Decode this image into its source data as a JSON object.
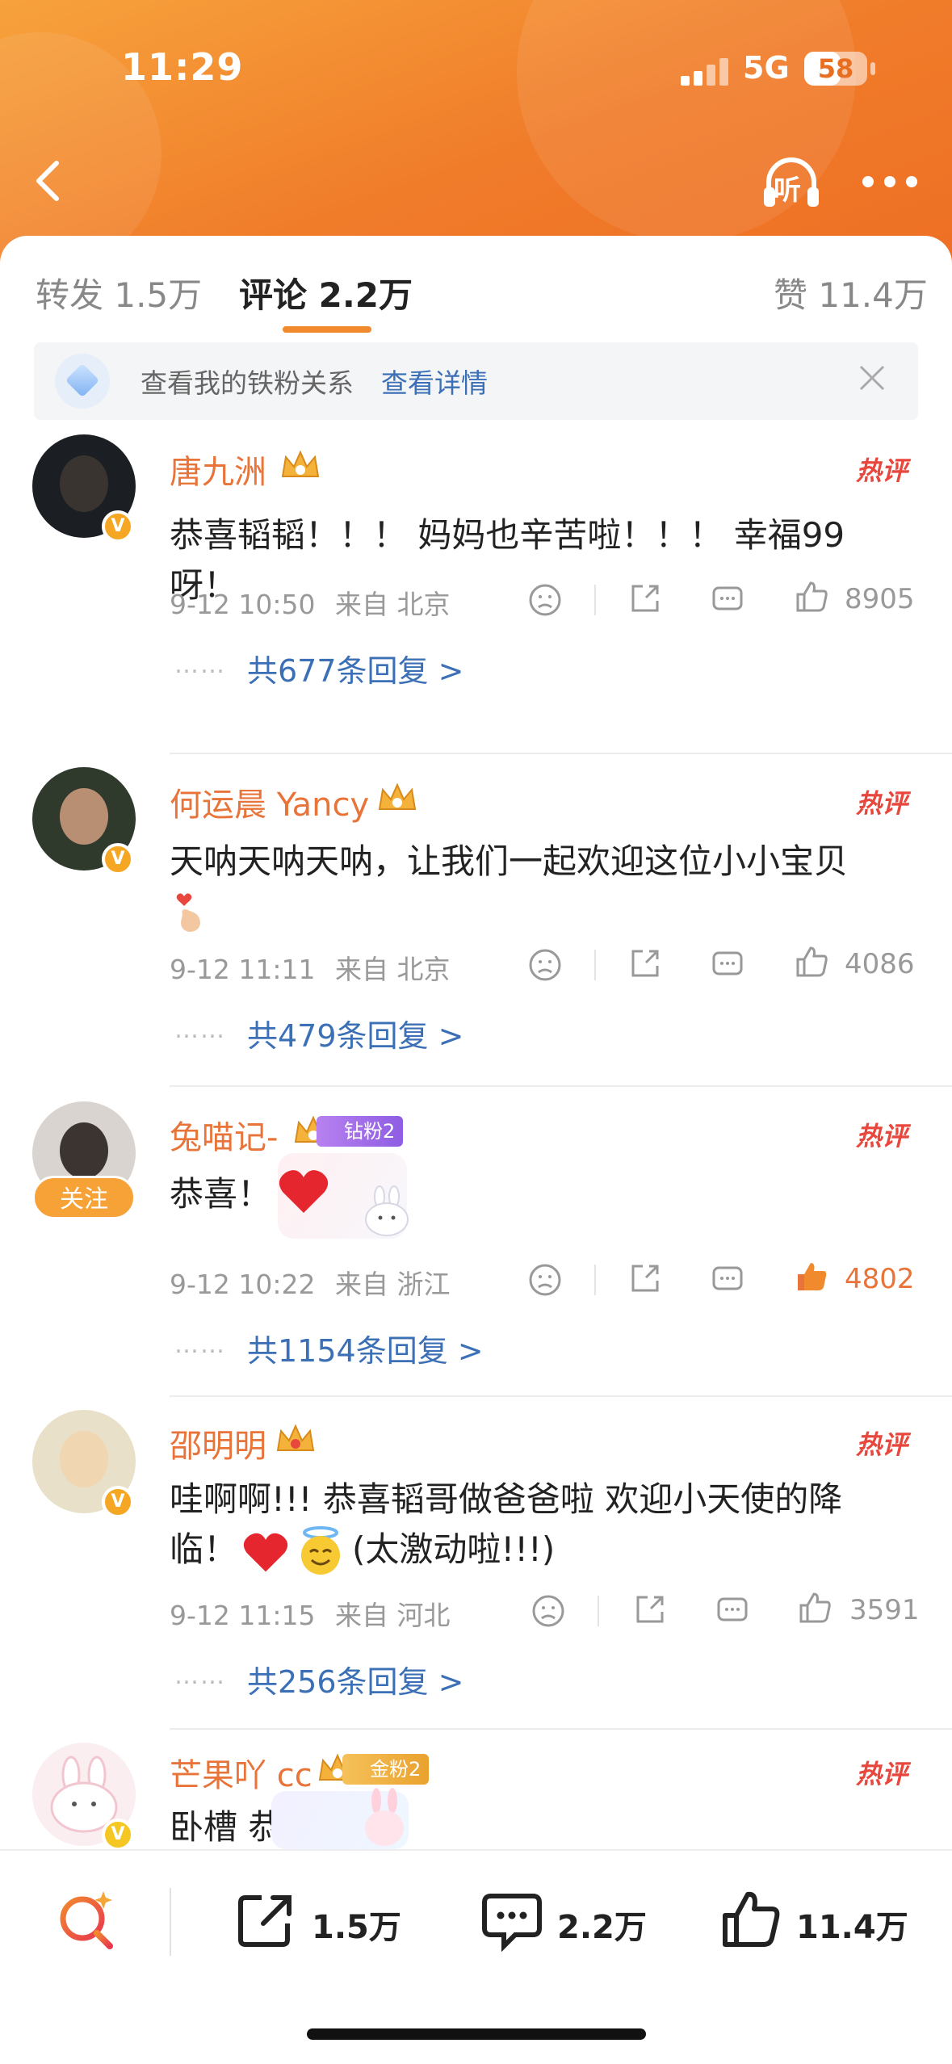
{
  "status_bar": {
    "time": "11:29",
    "network": "5G",
    "battery": "58"
  },
  "nav": {
    "listen_label": "听"
  },
  "tabs": [
    {
      "label": "转发 1.5万"
    },
    {
      "label": "评论 2.2万"
    },
    {
      "label": "赞 11.4万"
    }
  ],
  "fan_bar": {
    "text": "查看我的铁粉关系",
    "link": "查看详情"
  },
  "hot_label": "热评",
  "comments": [
    {
      "name": "唐九洲",
      "text": "恭喜韬韬！！！ 妈妈也辛苦啦！！！ 幸福99呀！",
      "time": "9-12 10:50",
      "location": "来自 北京",
      "likes": "8905",
      "replies": "共677条回复 >",
      "verified": "V"
    },
    {
      "name": "何运晨 Yancy",
      "text": "天呐天呐天呐，让我们一起欢迎这位小小宝贝",
      "time": "9-12 11:11",
      "location": "来自 北京",
      "likes": "4086",
      "replies": "共479条回复 >",
      "verified": "V"
    },
    {
      "name": "兔喵记-",
      "text": "恭喜！",
      "time": "9-12 10:22",
      "location": "来自 浙江",
      "likes": "4802",
      "replies": "共1154条回复 >",
      "follow": "关注",
      "fan_badge": "钻粉2"
    },
    {
      "name": "邵明明",
      "text": "哇啊啊!!! 恭喜韬哥做爸爸啦 欢迎小天使的降",
      "text2": "临！",
      "text3": "(太激动啦!!!)",
      "time": "9-12 11:15",
      "location": "来自 河北",
      "likes": "3591",
      "replies": "共256条回复 >",
      "verified": "V"
    },
    {
      "name": "芒果吖 cc",
      "text": "卧槽 恭喜",
      "fan_badge": "金粉2",
      "verified": "V"
    }
  ],
  "reply_dots": "……",
  "bottom_bar": {
    "repost": "1.5万",
    "comment": "2.2万",
    "like": "11.4万"
  },
  "colors": {
    "accent": "#f08a2c",
    "name": "#e8743a",
    "link": "#3b6fb6",
    "hot": "#e8473d"
  }
}
